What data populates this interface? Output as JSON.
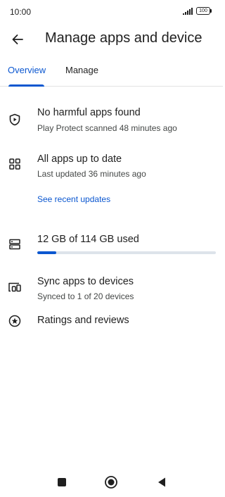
{
  "status_bar": {
    "time": "10:00",
    "battery": "100"
  },
  "app_bar": {
    "title": "Manage apps and device"
  },
  "tabs": [
    {
      "label": "Overview",
      "selected": true
    },
    {
      "label": "Manage",
      "selected": false
    }
  ],
  "colors": {
    "accent": "#0b57d0",
    "text": "#1f1f1f",
    "secondary_text": "#444746",
    "track": "#dde3ea"
  },
  "rows": {
    "protect": {
      "icon": "shield-play-icon",
      "title": "No harmful apps found",
      "subtitle": "Play Protect scanned 48 minutes ago"
    },
    "updates": {
      "icon": "apps-grid-icon",
      "title": "All apps up to date",
      "subtitle": "Last updated 36 minutes ago",
      "link": "See recent updates"
    },
    "storage": {
      "icon": "storage-icon",
      "title": "12 GB of 114 GB used",
      "used_fraction": 0.105
    },
    "sync": {
      "icon": "devices-icon",
      "title": "Sync apps to devices",
      "subtitle": "Synced to 1 of 20 devices"
    },
    "ratings": {
      "icon": "star-circle-icon",
      "title": "Ratings and reviews"
    }
  },
  "nav": [
    "recents-icon",
    "home-icon",
    "back-triangle-icon"
  ]
}
